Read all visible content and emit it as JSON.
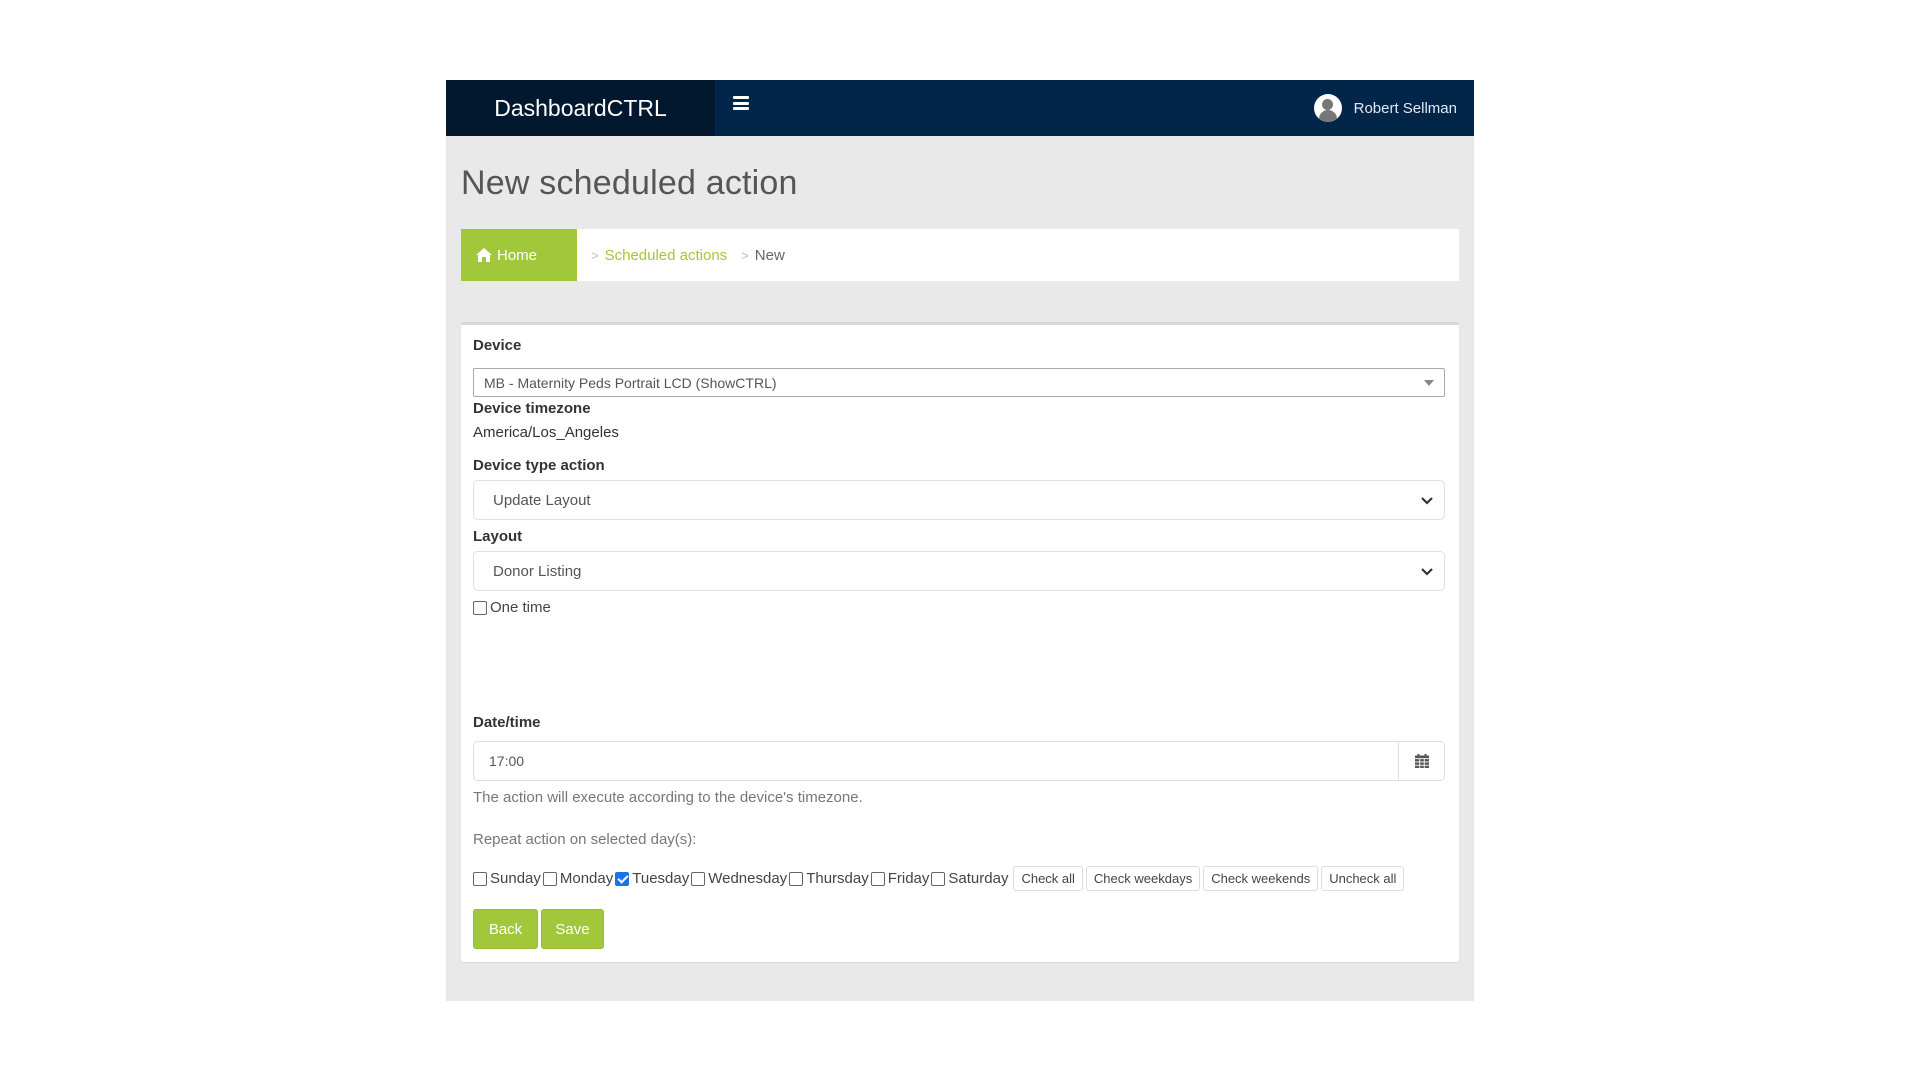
{
  "header": {
    "brand": "DashboardCTRL",
    "menu_icon": "hamburger-icon",
    "user_name": "Robert Sellman",
    "avatar_icon": "user-avatar-icon"
  },
  "page": {
    "title": "New scheduled action"
  },
  "breadcrumb": {
    "home": "Home",
    "home_icon": "home-icon",
    "separator": ">",
    "items": [
      "Scheduled actions",
      "New"
    ]
  },
  "form": {
    "device": {
      "label": "Device",
      "value": "MB - Maternity Peds Portrait LCD (ShowCTRL)"
    },
    "timezone": {
      "label": "Device timezone",
      "value": "America/Los_Angeles"
    },
    "device_type_action": {
      "label": "Device type action",
      "value": "Update Layout"
    },
    "layout": {
      "label": "Layout",
      "value": "Donor Listing"
    },
    "one_time": {
      "label": "One time",
      "checked": false
    },
    "datetime": {
      "label": "Date/time",
      "value": "17:00",
      "calendar_icon": "calendar-icon",
      "help": "The action will execute according to the device's timezone."
    },
    "repeat": {
      "label": "Repeat action on selected day(s):",
      "days": [
        {
          "name": "Sunday",
          "checked": false
        },
        {
          "name": "Monday",
          "checked": false
        },
        {
          "name": "Tuesday",
          "checked": true
        },
        {
          "name": "Wednesday",
          "checked": false
        },
        {
          "name": "Thursday",
          "checked": false
        },
        {
          "name": "Friday",
          "checked": false
        },
        {
          "name": "Saturday",
          "checked": false
        }
      ],
      "buttons": [
        "Check all",
        "Check weekdays",
        "Check weekends",
        "Uncheck all"
      ]
    },
    "actions": {
      "back": "Back",
      "save": "Save"
    }
  },
  "colors": {
    "accent": "#a1c83a",
    "topbar": "#02254a",
    "brand_bg": "#02182f",
    "page_bg": "#e9e9e9",
    "checkbox_checked": "#1a73e8"
  }
}
